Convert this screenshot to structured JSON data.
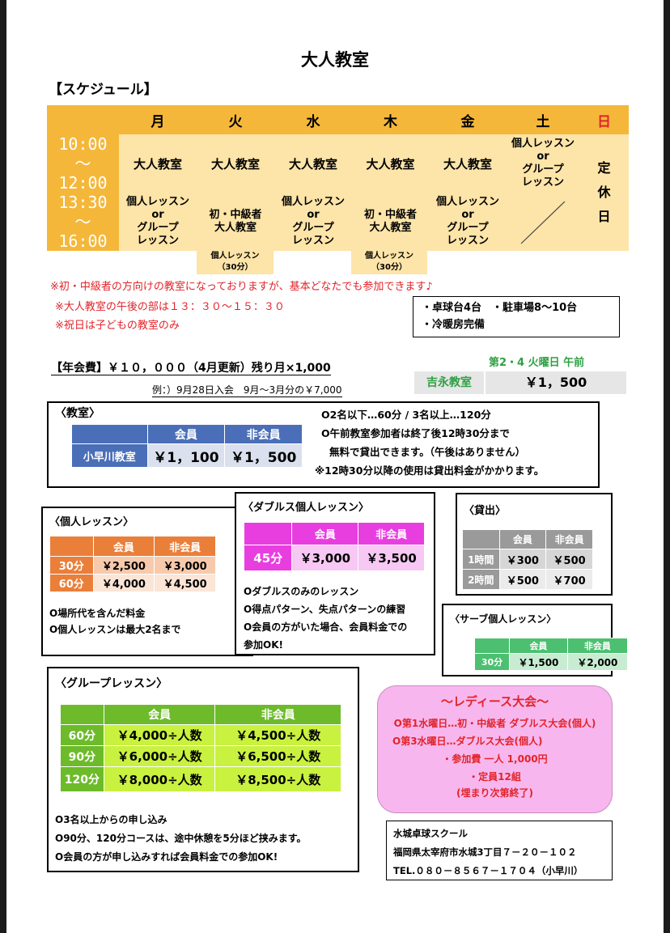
{
  "title": "大人教室",
  "schedule_heading": "【スケジュール】",
  "schedule": {
    "days": [
      "月",
      "火",
      "水",
      "木",
      "金",
      "土",
      "日"
    ],
    "morning": {
      "time": [
        "10:00",
        "〜",
        "12:00"
      ],
      "cells": [
        "大人教室",
        "大人教室",
        "大人教室",
        "大人教室",
        "大人教室"
      ],
      "sat": [
        "個人レッスン",
        "or",
        "グループ",
        "レッスン"
      ]
    },
    "afternoon": {
      "time": [
        "13:30",
        "〜",
        "16:00"
      ],
      "mon": [
        "個人レッスン",
        "or",
        "グループ",
        "レッスン"
      ],
      "tue": [
        "初・中級者",
        "大人教室"
      ],
      "wed": [
        "個人レッスン",
        "or",
        "グループ",
        "レッスン"
      ],
      "thu": [
        "初・中級者",
        "大人教室"
      ],
      "fri": [
        "個人レッスン",
        "or",
        "グループ",
        "レッスン"
      ]
    },
    "sunday": [
      "定",
      "休",
      "日"
    ],
    "sub_tue": [
      "個人レッスン",
      "（30分）"
    ],
    "sub_thu": [
      "個人レッスン",
      "（30分）"
    ]
  },
  "notes": {
    "n1": "※初・中級者の方向けの教室になっておりますが、基本どなたでも参加できます♪",
    "n2": "※大人教室の午後の部は１３：３０〜１５：３０",
    "n3": "※祝日は子どもの教室のみ"
  },
  "facilities": [
    "・卓球台4台　・駐車場8〜10台",
    "・冷暖房完備"
  ],
  "annual_fee": {
    "text": "【年会費】￥１０，０００（4月更新）残り月×1,000",
    "example": "例：）9月28日入会　9月〜3月分の￥7,000"
  },
  "yoshinaga": {
    "header": "第2・4 火曜日 午前",
    "name": "吉永教室",
    "price": "￥1，500"
  },
  "classroom": {
    "title": "〈教室〉",
    "headers": [
      "会員",
      "非会員"
    ],
    "row_label": "小早川教室",
    "member": "￥1，100",
    "nonmember": "￥1，500",
    "notes": [
      "O2名以下…60分 / 3名以上…120分",
      "O午前教室参加者は終了後12時30分まで",
      "無料で貸出できます。（午後はありません）",
      "※12時30分以降の使用は貸出料金がかかります。"
    ]
  },
  "private_lesson": {
    "title": "〈個人レッスン〉",
    "headers": [
      "会員",
      "非会員"
    ],
    "rows": [
      {
        "label": "30分",
        "member": "￥2,500",
        "nonmember": "￥3,000"
      },
      {
        "label": "60分",
        "member": "￥4,000",
        "nonmember": "￥4,500"
      }
    ],
    "notes": [
      "O場所代を含んだ料金",
      "O個人レッスンは最大2名まで"
    ]
  },
  "doubles_lesson": {
    "title": "〈ダブルス個人レッスン〉",
    "headers": [
      "会員",
      "非会員"
    ],
    "row_label": "45分",
    "member": "￥3,000",
    "nonmember": "￥3,500",
    "notes": [
      "Oダブルスのみのレッスン",
      "O得点パターン、失点パターンの練習",
      "O会員の方がいた場合、会員料金での",
      "参加OK!"
    ]
  },
  "rental": {
    "title": "〈貸出〉",
    "headers": [
      "会員",
      "非会員"
    ],
    "rows": [
      {
        "label": "1時間",
        "member": "￥300",
        "nonmember": "￥500"
      },
      {
        "label": "2時間",
        "member": "￥500",
        "nonmember": "￥700"
      }
    ]
  },
  "serve_lesson": {
    "title": "〈サーブ個人レッスン〉",
    "headers": [
      "会員",
      "非会員"
    ],
    "row_label": "30分",
    "member": "￥1,500",
    "nonmember": "￥2,000"
  },
  "group_lesson": {
    "title": "〈グループレッスン〉",
    "headers": [
      "会員",
      "非会員"
    ],
    "rows": [
      {
        "label": "60分",
        "member": "￥4,000÷人数",
        "nonmember": "￥4,500÷人数"
      },
      {
        "label": "90分",
        "member": "￥6,000÷人数",
        "nonmember": "￥6,500÷人数"
      },
      {
        "label": "120分",
        "member": "￥8,000÷人数",
        "nonmember": "￥8,500÷人数"
      }
    ],
    "notes": [
      "O3名以上からの申し込み",
      "O90分、120分コースは、途中休憩を5分ほど挟みます。",
      "O会員の方が申し込みすれば会員料金での参加OK!"
    ]
  },
  "ladies": {
    "title": "〜レディース大会〜",
    "lines": [
      "O第1水曜日…初・中級者 ダブルス大会(個人)",
      "O第3水曜日…ダブルス大会(個人)",
      "・参加費 一人 1,000円",
      "・定員12組",
      "(埋まり次第終了)"
    ]
  },
  "contact": {
    "name": "水城卓球スクール",
    "address": "福岡県太宰府市水城3丁目７－２０－１０２",
    "tel": "TEL.０８０－８５６７－１７０４（小早川）"
  },
  "colors": {
    "schedule_header": "#f5b73a",
    "schedule_body": "#fde4a8",
    "classroom_blue": "#4a6fb8",
    "orange": "#ea7f3a",
    "magenta": "#e83ee0",
    "gray": "#9a9a9a",
    "green": "#4cc070",
    "group_green": "#6dbb2a",
    "lime": "#c9f13f",
    "ladies_pink": "#f7b7ee",
    "ladies_text": "#e2232a",
    "note_red": "#e2232a"
  }
}
